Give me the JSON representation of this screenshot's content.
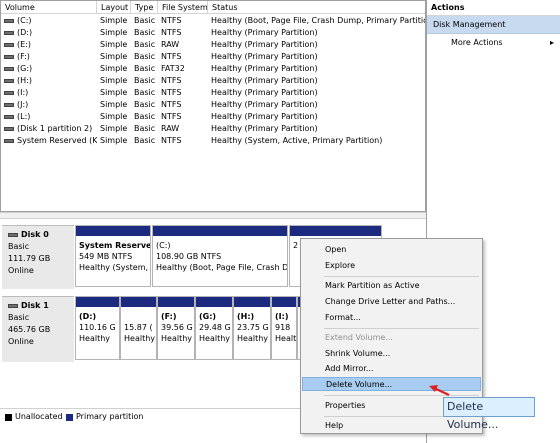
{
  "volume_table": {
    "headers": [
      "Volume",
      "Layout",
      "Type",
      "File System",
      "Status"
    ],
    "rows": [
      [
        "(C:)",
        "Simple",
        "Basic",
        "NTFS",
        "Healthy (Boot, Page File, Crash Dump, Primary Partition)"
      ],
      [
        "(D:)",
        "Simple",
        "Basic",
        "NTFS",
        "Healthy (Primary Partition)"
      ],
      [
        "(E:)",
        "Simple",
        "Basic",
        "RAW",
        "Healthy (Primary Partition)"
      ],
      [
        "(F:)",
        "Simple",
        "Basic",
        "NTFS",
        "Healthy (Primary Partition)"
      ],
      [
        "(G:)",
        "Simple",
        "Basic",
        "FAT32",
        "Healthy (Primary Partition)"
      ],
      [
        "(H:)",
        "Simple",
        "Basic",
        "NTFS",
        "Healthy (Primary Partition)"
      ],
      [
        "(I:)",
        "Simple",
        "Basic",
        "NTFS",
        "Healthy (Primary Partition)"
      ],
      [
        "(J:)",
        "Simple",
        "Basic",
        "NTFS",
        "Healthy (Primary Partition)"
      ],
      [
        "(L:)",
        "Simple",
        "Basic",
        "NTFS",
        "Healthy (Primary Partition)"
      ],
      [
        "(Disk 1 partition 2)",
        "Simple",
        "Basic",
        "RAW",
        "Healthy (Primary Partition)"
      ],
      [
        "System Reserved (K:)",
        "Simple",
        "Basic",
        "NTFS",
        "Healthy (System, Active, Primary Partition)"
      ]
    ]
  },
  "disk0": {
    "name": "Disk 0",
    "type": "Basic",
    "size": "111.79 GB",
    "state": "Online",
    "partitions": [
      {
        "name": "System Reserve",
        "size": "549 MB NTFS",
        "status": "Healthy (System,"
      },
      {
        "name": "(C:)",
        "size": "108.90 GB NTFS",
        "status": "Healthy (Boot, Page File, Crash Du"
      },
      {
        "name": "2",
        "size": "",
        "status": ""
      }
    ]
  },
  "disk1": {
    "name": "Disk 1",
    "type": "Basic",
    "size": "465.76 GB",
    "state": "Online",
    "partitions": [
      {
        "name": "(D:)",
        "size": "110.16 G",
        "status": "Healthy"
      },
      {
        "name": "",
        "size": "15.87 (",
        "status": "Healthy"
      },
      {
        "name": "(F:)",
        "size": "39.56 G",
        "status": "Healthy"
      },
      {
        "name": "(G:)",
        "size": "29.48 G",
        "status": "Healthy"
      },
      {
        "name": "(H:)",
        "size": "23.75 G",
        "status": "Healthy"
      },
      {
        "name": "(I:)",
        "size": "918",
        "status": "Healt"
      }
    ]
  },
  "legend": {
    "unallocated": "Unallocated",
    "primary": "Primary partition"
  },
  "actions": {
    "header": "Actions",
    "section": "Disk Management",
    "more": "More Actions",
    "more_arrow": "▸"
  },
  "context_menu": {
    "items": [
      {
        "label": "Open",
        "disabled": false
      },
      {
        "label": "Explore",
        "disabled": false
      },
      {
        "label": "Mark Partition as Active",
        "disabled": false
      },
      {
        "label": "Change Drive Letter and Paths...",
        "disabled": false
      },
      {
        "label": "Format...",
        "disabled": false
      },
      {
        "label": "Extend Volume...",
        "disabled": true
      },
      {
        "label": "Shrink Volume...",
        "disabled": false
      },
      {
        "label": "Add Mirror...",
        "disabled": false
      },
      {
        "label": "Delete Volume...",
        "disabled": false,
        "selected": true
      },
      {
        "label": "Properties",
        "disabled": false
      },
      {
        "label": "Help",
        "disabled": false
      }
    ]
  },
  "tooltip": {
    "text": "Delete Volume..."
  },
  "colors": {
    "primary_partition": "#1c2b80",
    "unallocated": "#000000",
    "selected_menu": "#a9cdf0",
    "annotation_arrow": "#e02020"
  }
}
